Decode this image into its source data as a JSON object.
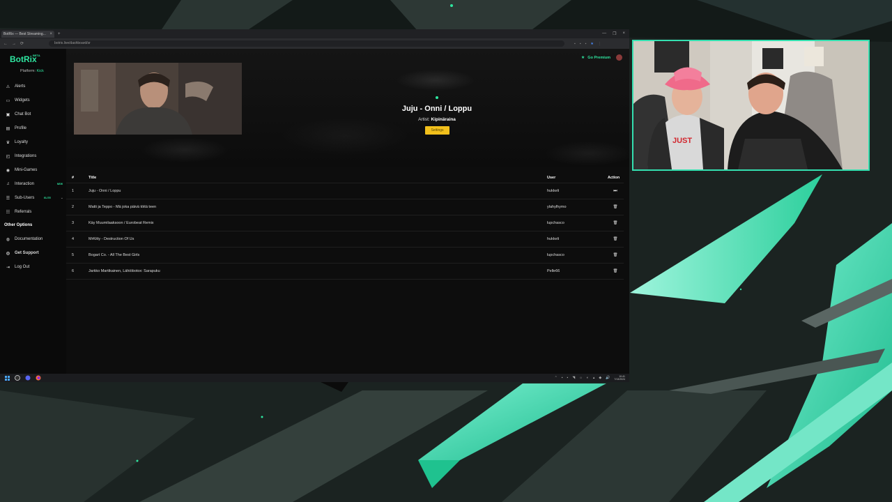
{
  "browser": {
    "tab_title": "BotRix — Best Streaming...",
    "tab_close": "×",
    "new_tab": "+",
    "url": "botrix.live/dashboard/sr",
    "window_controls": [
      "—",
      "❐",
      "×"
    ],
    "nav_buttons": [
      "←",
      "→",
      "⟳"
    ]
  },
  "app": {
    "logo": "BotRix",
    "logo_badge": "BETA",
    "platform_label": "Platform:",
    "platform_value": "Kick",
    "go_premium": "Go Premium"
  },
  "sidebar": {
    "items": [
      {
        "label": "Alerts",
        "icon": "alert-icon",
        "glyph": "⚠"
      },
      {
        "label": "Widgets",
        "icon": "widgets-icon",
        "glyph": "▭"
      },
      {
        "label": "Chat Bot",
        "icon": "chat-icon",
        "glyph": "▣"
      },
      {
        "label": "Profile",
        "icon": "profile-icon",
        "glyph": "▤"
      },
      {
        "label": "Loyalty",
        "icon": "trophy-icon",
        "glyph": "♛"
      },
      {
        "label": "Integrations",
        "icon": "integrations-icon",
        "glyph": "◰"
      },
      {
        "label": "Mini-Games",
        "icon": "gamepad-icon",
        "glyph": "◉"
      },
      {
        "label": "Interaction",
        "icon": "music-icon",
        "glyph": "♫",
        "badge": "NEW"
      },
      {
        "label": "Sub-Users",
        "icon": "users-icon",
        "glyph": "☰",
        "badge": "ELITE",
        "chevron": "⌄"
      },
      {
        "label": "Referrals",
        "icon": "referrals-icon",
        "glyph": "☷"
      }
    ],
    "section_title": "Other Options",
    "other_items": [
      {
        "label": "Documentation",
        "icon": "docs-icon",
        "glyph": "◍"
      },
      {
        "label": "Get Support",
        "icon": "support-icon",
        "glyph": "◎"
      },
      {
        "label": "Log Out",
        "icon": "logout-icon",
        "glyph": "⇥"
      }
    ]
  },
  "now_playing": {
    "title": "Juju - Onni / Loppu",
    "artist_label": "Artist:",
    "artist": "Kipinäraina",
    "settings_button": "Settings"
  },
  "queue": {
    "headers": {
      "num": "#",
      "title": "Title",
      "user": "User",
      "action": "Action"
    },
    "rows": [
      {
        "num": "1",
        "title": "Juju - Onni / Loppu",
        "user": "hukkeli",
        "action": "skip-icon",
        "glyph": "⏭"
      },
      {
        "num": "2",
        "title": "Matti ja Teppo - Mä joka päivä töitä teen",
        "user": "ylahylhymo",
        "action": "trash-icon",
        "glyph": "🗑"
      },
      {
        "num": "3",
        "title": "Käy Muumilaaksoon / Eurobeat Remix",
        "user": "lupchasco",
        "action": "trash-icon",
        "glyph": "🗑"
      },
      {
        "num": "4",
        "title": "MrKitty - Destruction Of Us",
        "user": "hukkeli",
        "action": "trash-icon",
        "glyph": "🗑"
      },
      {
        "num": "5",
        "title": "Bogart Co. - All The Best Girls",
        "user": "lupchasco",
        "action": "trash-icon",
        "glyph": "🗑"
      },
      {
        "num": "6",
        "title": "Jarkko Martikainen, Lähiöbotox: Sarapuku",
        "user": "Pelle66",
        "action": "trash-icon",
        "glyph": "🗑"
      }
    ]
  },
  "taskbar": {
    "icons": [
      "windows-start-icon",
      "obs-icon",
      "discord-icon",
      "firefox-icon"
    ],
    "tray_glyphs": [
      "⌃",
      "▪",
      "▪",
      "◥",
      "☼",
      "◐",
      "▴",
      "◆",
      "🔊"
    ],
    "time": "10:41",
    "date": "7/13/2024"
  },
  "colors": {
    "accent": "#2ee6a0",
    "premium": "#2ee6a0",
    "settings_button": "#f2c01c",
    "webcam_border": "#34e0b0"
  }
}
